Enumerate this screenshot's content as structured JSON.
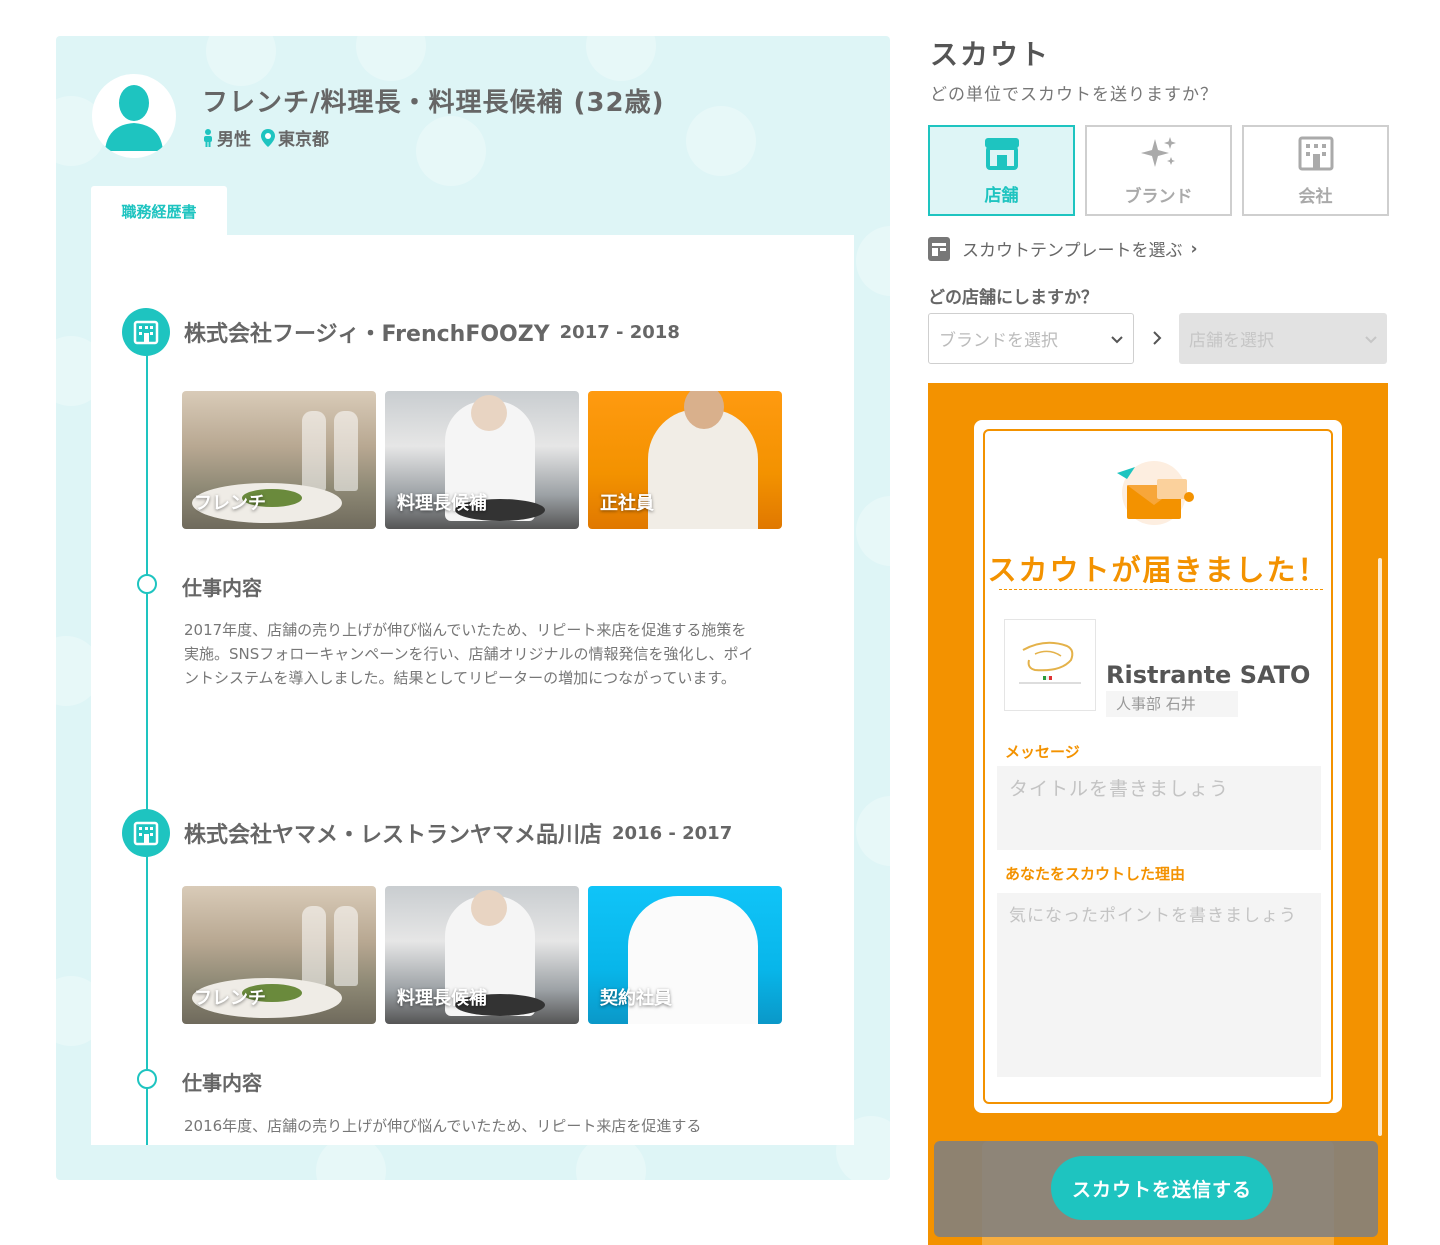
{
  "profile": {
    "title": "フレンチ/料理長・料理長候補 (32歳)",
    "gender": "男性",
    "location": "東京都"
  },
  "tabs": {
    "resume": "職務経歴書"
  },
  "career": [
    {
      "company": "株式会社フージィ・FrenchFOOZY",
      "years": "2017 - 2018",
      "tags": [
        "フレンチ",
        "料理長候補",
        "正社員"
      ],
      "section_title": "仕事内容",
      "description": "2017年度、店舗の売り上げが伸び悩んでいたため、リピート来店を促進する施策を実施。SNSフォローキャンペーンを行い、店舗オリジナルの情報発信を強化し、ポイントシステムを導入しました。結果としてリピーターの増加につながっています。"
    },
    {
      "company": "株式会社ヤマメ・レストランヤマメ品川店",
      "years": "2016 - 2017",
      "tags": [
        "フレンチ",
        "料理長候補",
        "契約社員"
      ],
      "section_title": "仕事内容",
      "description": "2016年度、店舗の売り上げが伸び悩んでいたため、リピート来店を促進する"
    }
  ],
  "scout": {
    "title": "スカウト",
    "question": "どの単位でスカウトを送りますか？",
    "units": [
      {
        "label": "店舗",
        "icon": "store-icon",
        "active": true
      },
      {
        "label": "ブランド",
        "icon": "sparkle-icon",
        "active": false
      },
      {
        "label": "会社",
        "icon": "building-icon",
        "active": false
      }
    ],
    "template_link": "スカウトテンプレートを選ぶ",
    "which_store": "どの店舗にしますか？",
    "brand_select_placeholder": "ブランドを選択",
    "store_select_placeholder": "店舗を選択"
  },
  "preview": {
    "headline": "スカウトが届きました！",
    "restaurant": "Ristrante SATO",
    "sender": "人事部 石井",
    "message_label": "メッセージ",
    "title_placeholder": "タイトルを書きましょう",
    "reason_label": "あなたをスカウトした理由",
    "reason_placeholder": "気になったポイントを書きましょう",
    "send_button": "スカウトを送信する"
  },
  "colors": {
    "accent": "#1ec4c0",
    "orange": "#f39200",
    "panel_bg": "#def5f6"
  }
}
